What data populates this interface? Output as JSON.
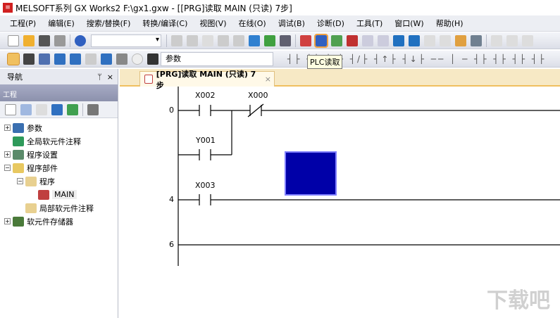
{
  "title": "MELSOFT系列 GX Works2 F:\\gx1.gxw - [[PRG]读取 MAIN (只读) 7步]",
  "menu": [
    "工程(P)",
    "编辑(E)",
    "搜索/替换(F)",
    "转换/编译(C)",
    "视图(V)",
    "在线(O)",
    "调试(B)",
    "诊断(D)",
    "工具(T)",
    "窗口(W)",
    "帮助(H)"
  ],
  "toolbar": {
    "search_value": "参数",
    "tooltip": "PLC读取"
  },
  "nav": {
    "title": "导航",
    "section": "工程",
    "pin": "ᛘ",
    "close": "×",
    "tree": [
      {
        "label": "参数",
        "exp": "+",
        "indent": 0,
        "color": "#3a6fb0"
      },
      {
        "label": "全局软元件注释",
        "exp": "",
        "indent": 0,
        "color": "#2e9a5a"
      },
      {
        "label": "程序设置",
        "exp": "+",
        "indent": 0,
        "color": "#5a8a6a"
      },
      {
        "label": "程序部件",
        "exp": "−",
        "indent": 0,
        "color": "#e8c860"
      },
      {
        "label": "程序",
        "exp": "−",
        "indent": 1,
        "color": "#e8d090"
      },
      {
        "label": "MAIN",
        "exp": "",
        "indent": 2,
        "color": "#c04040"
      },
      {
        "label": "局部软元件注释",
        "exp": "",
        "indent": 1,
        "color": "#e8d090"
      },
      {
        "label": "软元件存储器",
        "exp": "+",
        "indent": 0,
        "color": "#4a7a3a"
      }
    ]
  },
  "tab": {
    "label": "[PRG]读取 MAIN (只读) 7步",
    "close": "×"
  },
  "ladder": {
    "steps": [
      "0",
      "4",
      "6"
    ],
    "contacts": [
      "X002",
      "X000",
      "Y001",
      "X003"
    ]
  },
  "watermark": "下载吧"
}
